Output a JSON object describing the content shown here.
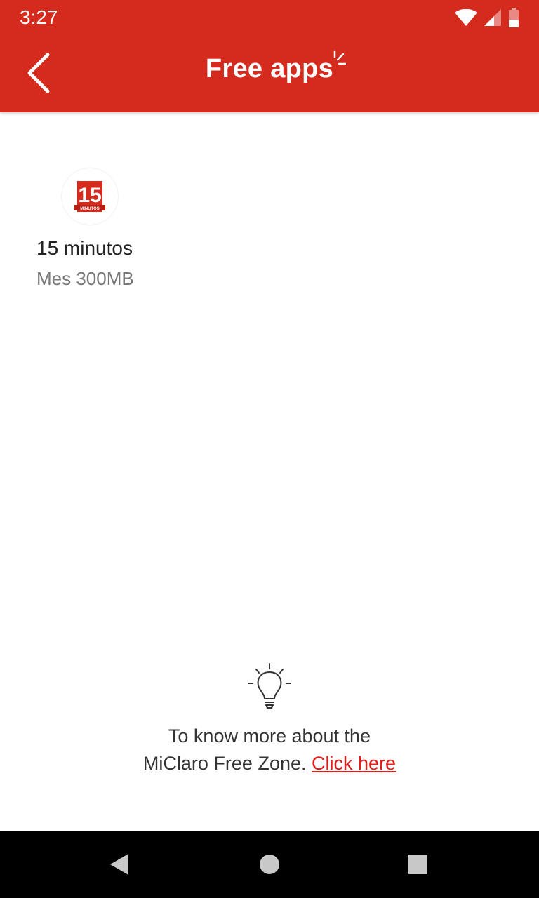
{
  "status_bar": {
    "time": "3:27",
    "icons": [
      "wifi-icon",
      "cell-signal-icon",
      "battery-icon"
    ]
  },
  "header": {
    "title": "Free apps",
    "back_icon": "back-arrow-icon",
    "color": "#d52b1e"
  },
  "apps": [
    {
      "name": "15 minutos",
      "plan": "Mes 300MB",
      "logo_text": "15",
      "logo_subtext": "MINUTOS"
    }
  ],
  "info": {
    "line1": "To know more about the",
    "line2": "MiClaro Free Zone.",
    "link": "Click here",
    "icon": "lightbulb-icon",
    "link_color": "#e31d1a"
  },
  "nav_bar": {
    "buttons": [
      "back-triangle-icon",
      "home-circle-icon",
      "recents-square-icon"
    ]
  }
}
